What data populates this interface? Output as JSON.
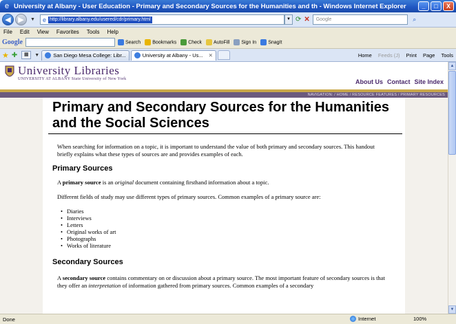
{
  "window": {
    "title": "University at Albany - User Education - Primary and Secondary Sources for the Humanities and th - Windows Internet Explorer",
    "buttons": {
      "minimize": "_",
      "maximize": "□",
      "close": "X"
    }
  },
  "address_bar": {
    "url": "http://library.albany.edu/usered/cdr/primary.html",
    "search_placeholder": "Google"
  },
  "menu": [
    "File",
    "Edit",
    "View",
    "Favorites",
    "Tools",
    "Help"
  ],
  "google_toolbar": {
    "logo": "Google",
    "items": [
      "Search",
      "Bookmarks",
      "Check",
      "AutoFill",
      "Sign In",
      "SnagIt"
    ]
  },
  "tabs": {
    "items": [
      {
        "label": "San Diego Mesa College: Libr..."
      },
      {
        "label": "University at Albany - Us..."
      }
    ],
    "commands": [
      "Home",
      "Feeds (J)",
      "Print",
      "Page",
      "Tools"
    ]
  },
  "library_header": {
    "name": "University Libraries",
    "subtitle": "UNIVERSITY AT ALBANY  State University of New York",
    "links": [
      "About Us",
      "Contact",
      "Site Index"
    ],
    "navpath": "NAVIGATION: / HOME / RESOURCE FEATURES / PRIMARY RESOURCES"
  },
  "article": {
    "title": "Primary and Secondary Sources for the Humanities and the Social Sciences",
    "intro": "When searching for information on a topic, it is important to understand the value of both primary and secondary sources. This handout briefly explains what these types of sources are and provides examples of each.",
    "primary_heading": "Primary Sources",
    "primary_def_pre": "A ",
    "primary_def_term": "primary source",
    "primary_def_mid": " is an ",
    "primary_def_em": "original",
    "primary_def_post": " document containing firsthand information about a topic.",
    "primary_fields": "Different fields of study may use different types of primary sources. Common examples of a primary source are:",
    "primary_examples": [
      "Diaries",
      "Interviews",
      "Letters",
      "Original works of art",
      "Photographs",
      "Works of literature"
    ],
    "secondary_heading": "Secondary Sources",
    "secondary_pre": "A ",
    "secondary_term": "secondary source",
    "secondary_mid": " contains commentary on or discussion about a primary source. The most important feature of secondary sources is that they offer an ",
    "secondary_em": "interpretation",
    "secondary_post": " of information gathered from primary sources. Common examples of a secondary"
  },
  "status": {
    "text": "Done",
    "zone": "Internet",
    "zoom": "100%"
  }
}
